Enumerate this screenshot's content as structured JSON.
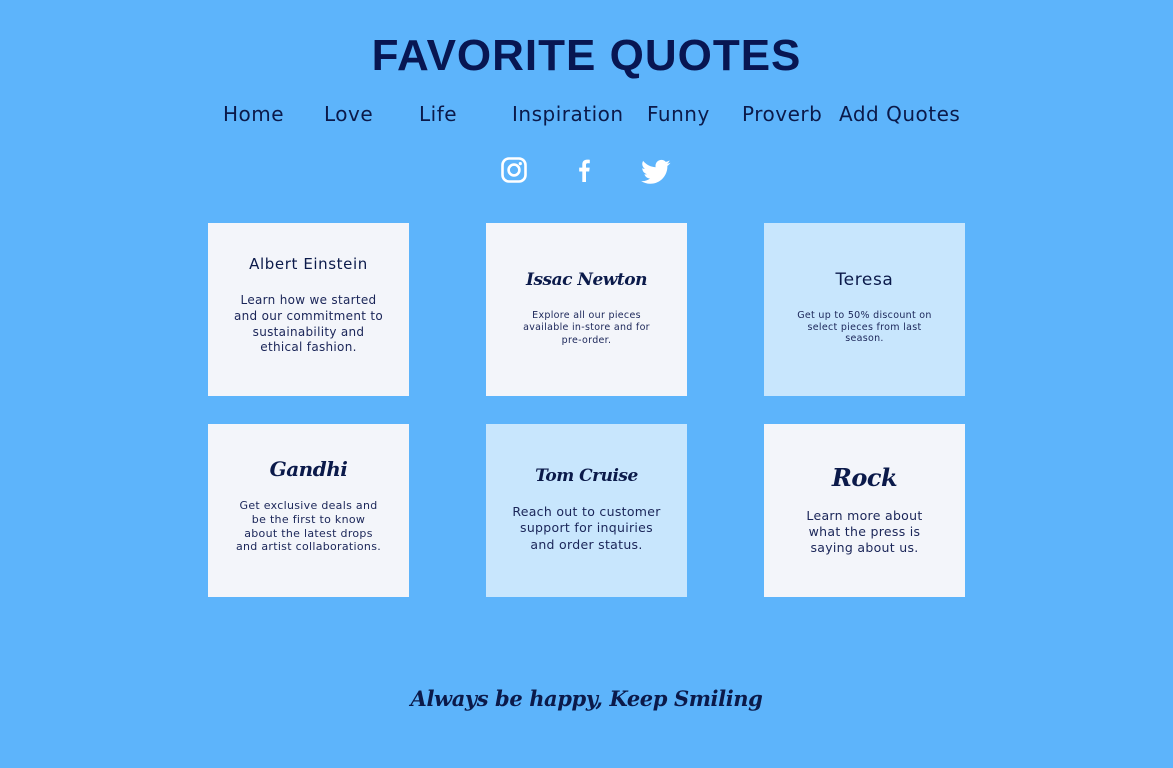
{
  "header": {
    "title": "FAVORITE QUOTES"
  },
  "nav": {
    "items": [
      {
        "label": "Home"
      },
      {
        "label": "Love"
      },
      {
        "label": "Life"
      },
      {
        "label": "Inspiration"
      },
      {
        "label": "Funny"
      },
      {
        "label": "Proverb"
      },
      {
        "label": "Add Quotes"
      }
    ]
  },
  "social": {
    "icons": [
      "instagram-icon",
      "facebook-icon",
      "twitter-icon"
    ],
    "icon_color": "#ffffff"
  },
  "colors": {
    "background": "#5db4fb",
    "card_light": "#f3f5fa",
    "card_blue": "#c8e6fd",
    "text_dark": "#0b1a4a"
  },
  "cards": [
    {
      "name": "Albert Einstein",
      "text": "Learn how we started and our commitment to sustainability and ethical fashion."
    },
    {
      "name": "Issac Newton",
      "text": "Explore all our pieces available in-store and for pre-order."
    },
    {
      "name": "Teresa",
      "text": "Get up to 50% discount on select pieces from last season."
    },
    {
      "name": "Gandhi",
      "text": "Get exclusive deals and be the first to know about the latest drops and artist collaborations."
    },
    {
      "name": "Tom Cruise",
      "text": "Reach out to customer support for inquiries and order status."
    },
    {
      "name": "Rock",
      "text": "Learn more about what the press is saying about us."
    }
  ],
  "footer": {
    "tagline": "Always be happy, Keep Smiling"
  }
}
